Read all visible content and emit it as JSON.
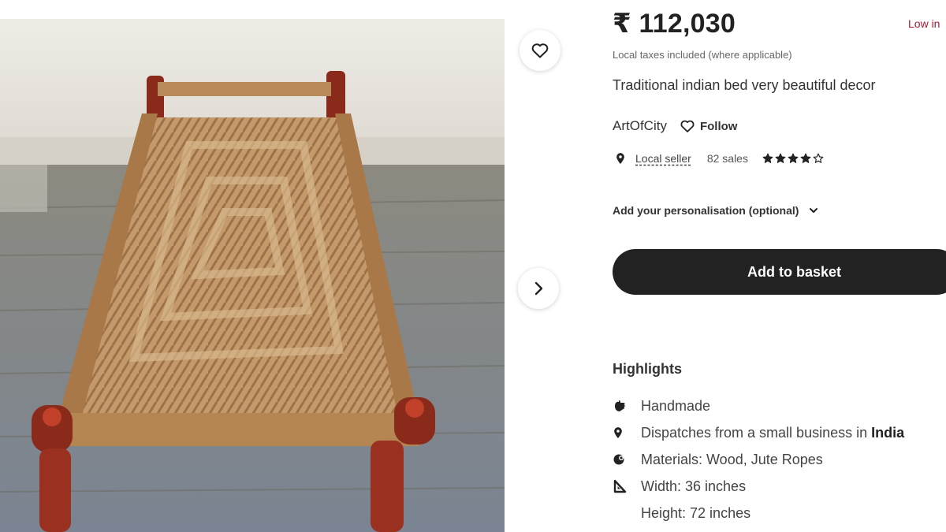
{
  "product": {
    "price": "₹ 112,030",
    "stock_note": "Low in",
    "tax_note": "Local taxes included (where applicable)",
    "title": "Traditional indian bed very beautiful decor"
  },
  "shop": {
    "name": "ArtOfCity",
    "follow_label": "Follow",
    "seller_label": "Local seller",
    "sales": "82 sales",
    "rating": 4
  },
  "personalisation": {
    "label": "Add your personalisation (optional)"
  },
  "actions": {
    "add_to_basket": "Add to basket"
  },
  "highlights": {
    "title": "Highlights",
    "items": [
      {
        "icon": "handmade-icon",
        "text": "Handmade"
      },
      {
        "icon": "location-pin-icon",
        "text": "Dispatches from a small business in ",
        "bold": "India"
      },
      {
        "icon": "materials-icon",
        "text": "Materials: Wood, Jute Ropes"
      },
      {
        "icon": "ruler-icon",
        "text": "Width: 36 inches"
      },
      {
        "icon": "",
        "text": "Height: 72 inches"
      }
    ]
  },
  "icons": {
    "favorite": "heart-icon",
    "next": "chevron-right-icon",
    "follow": "heart-outline-icon",
    "dropdown": "chevron-down-icon"
  },
  "colors": {
    "button_bg": "#222222",
    "stock_text": "#a61a2e"
  }
}
